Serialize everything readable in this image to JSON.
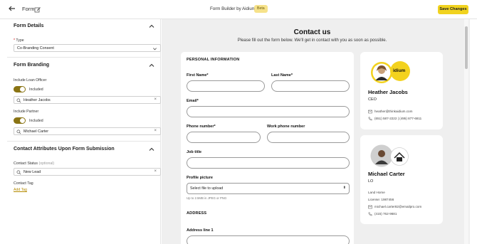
{
  "topbar": {
    "title": "Form",
    "center_title": "Form Builder by Aidium",
    "beta_badge": "Beta",
    "save_label": "Save Changes"
  },
  "form_details": {
    "section_title": "Form Details",
    "type_label": "Type",
    "type_value": "Co-Branding Consent"
  },
  "form_branding": {
    "section_title": "Form Branding",
    "loan_officer_label": "Include Loan Officer",
    "loan_officer_toggle": "Included",
    "loan_officer_value": "Heather Jacobs",
    "partner_label": "Include Partner",
    "partner_toggle": "Included",
    "partner_value": "Michael Carter"
  },
  "contact_attributes": {
    "section_title": "Contact Attributes Upon Form Submission",
    "status_label": "Contact Status",
    "status_optional": "(optional)",
    "status_value": "New Lead",
    "tag_label": "Contact Tag",
    "add_tag_link": "Add Tag"
  },
  "preview": {
    "heading": "Contact us",
    "subheading": "Please fill out the form below. We'll get in contact with you as soon as possible.",
    "personal_section": "PERSONAL INFORMATION",
    "first_name": "First Name*",
    "last_name": "Last Name*",
    "email": "Email*",
    "phone": "Phone number*",
    "work_phone": "Work phone number",
    "job_title": "Job title",
    "profile_picture": "Profile picture",
    "upload_select": "Select file to upload",
    "upload_hint": "Up to 2.5MB in JPEG or PNG",
    "address_section": "ADDRESS",
    "address_line1": "Address line 1"
  },
  "loan_officer_card": {
    "logo_text": "idium",
    "name": "Heather Jacobs",
    "role": "CEO",
    "email": "heather@thinkaidium.com",
    "phones": "(651) 587-2222  |  (495) 877-6811"
  },
  "partner_card": {
    "name": "Michael Carter",
    "role": "LO",
    "company": "Land Home",
    "license": "License: 1987456",
    "email": "michael.carter82@emailpro.com",
    "phone": "(415) 762-9681"
  },
  "colors": {
    "accent": "#f1d31f",
    "toggle_on": "#8a7414",
    "link": "#b48a00"
  }
}
